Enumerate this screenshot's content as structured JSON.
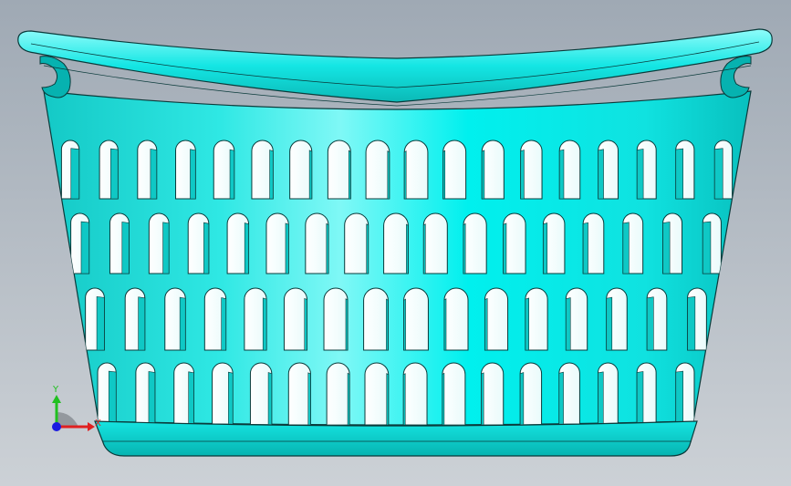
{
  "viewport": {
    "background_top": "#9fa9b4",
    "background_bottom": "#ccd1d6"
  },
  "model": {
    "name": "laundry-basket",
    "body_color": "#00f2f0",
    "edge_color": "#0a3a3a",
    "hole_color": "#ffffff",
    "hole_rows": 4
  },
  "triad": {
    "x_label": "X",
    "y_label": "Y",
    "x_color": "#e02020",
    "y_color": "#20c020",
    "z_color": "#1a1ae0"
  }
}
